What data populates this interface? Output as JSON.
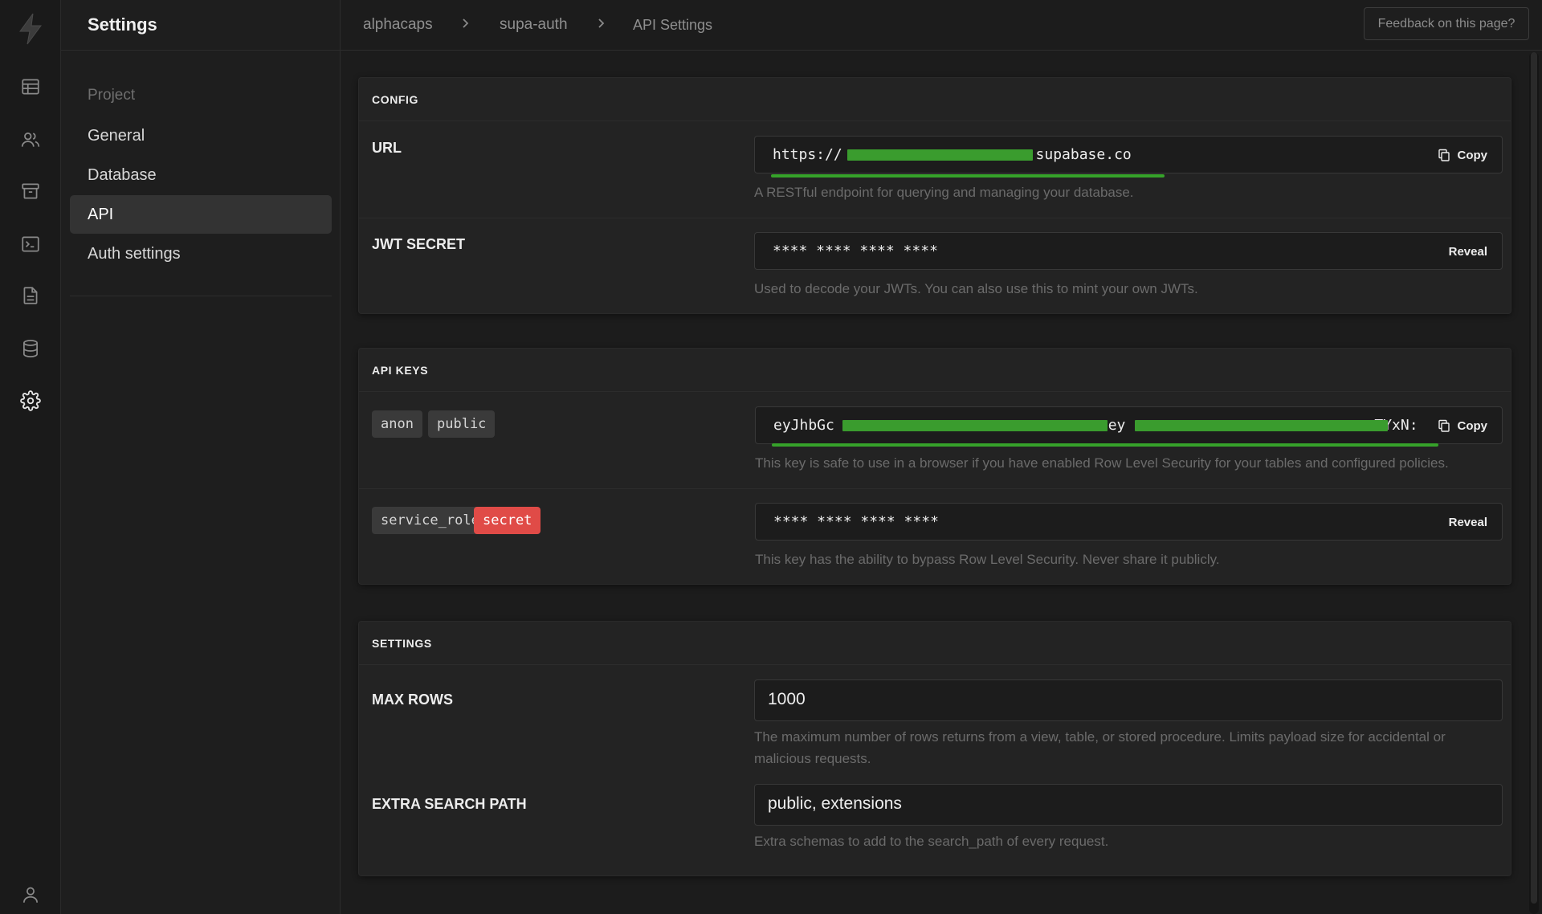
{
  "rail": {
    "items": [
      "logo-icon",
      "table-editor-icon",
      "users-icon",
      "storage-icon",
      "sql-editor-icon",
      "docs-icon",
      "database-icon",
      "settings-icon",
      "profile-icon"
    ]
  },
  "sidebar": {
    "title": "Settings",
    "section": "Project",
    "items": [
      {
        "label": "General",
        "active": false
      },
      {
        "label": "Database",
        "active": false
      },
      {
        "label": "API",
        "active": true
      },
      {
        "label": "Auth settings",
        "active": false
      }
    ]
  },
  "topbar": {
    "breadcrumb": [
      "alphacaps",
      "supa-auth",
      "API Settings"
    ],
    "feedback_label": "Feedback on this page?"
  },
  "config": {
    "title": "CONFIG",
    "url_label": "URL",
    "url_prefix": "https://",
    "url_suffix": ".supabase.co",
    "url_help": "A RESTful endpoint for querying and managing your database.",
    "copy_label": "Copy",
    "jwt_label": "JWT SECRET",
    "jwt_value": "**** **** **** ****",
    "jwt_help": "Used to decode your JWTs. You can also use this to mint your own JWTs.",
    "reveal_label": "Reveal"
  },
  "api_keys": {
    "title": "API KEYS",
    "anon_tags": [
      "anon",
      "public"
    ],
    "anon_value_start": "eyJhbGc",
    "anon_value_mid": ".ey",
    "anon_value_end": "TYxN:",
    "anon_help": "This key is safe to use in a browser if you have enabled Row Level Security for your tables and configured policies.",
    "copy_label": "Copy",
    "service_tags": [
      "service_role",
      "secret"
    ],
    "service_value": "**** **** **** ****",
    "service_help": "This key has the ability to bypass Row Level Security. Never share it publicly.",
    "reveal_label": "Reveal"
  },
  "settings": {
    "title": "SETTINGS",
    "max_rows_label": "MAX ROWS",
    "max_rows_value": "1000",
    "max_rows_help": "The maximum number of rows returns from a view, table, or stored procedure. Limits payload size for accidental or malicious requests.",
    "search_path_label": "EXTRA SEARCH PATH",
    "search_path_value": "public, extensions",
    "search_path_help": "Extra schemas to add to the search_path of every request."
  },
  "colors": {
    "accent": "#3ecf8e",
    "danger": "#e04b47",
    "redaction": "#3a9c2e"
  }
}
